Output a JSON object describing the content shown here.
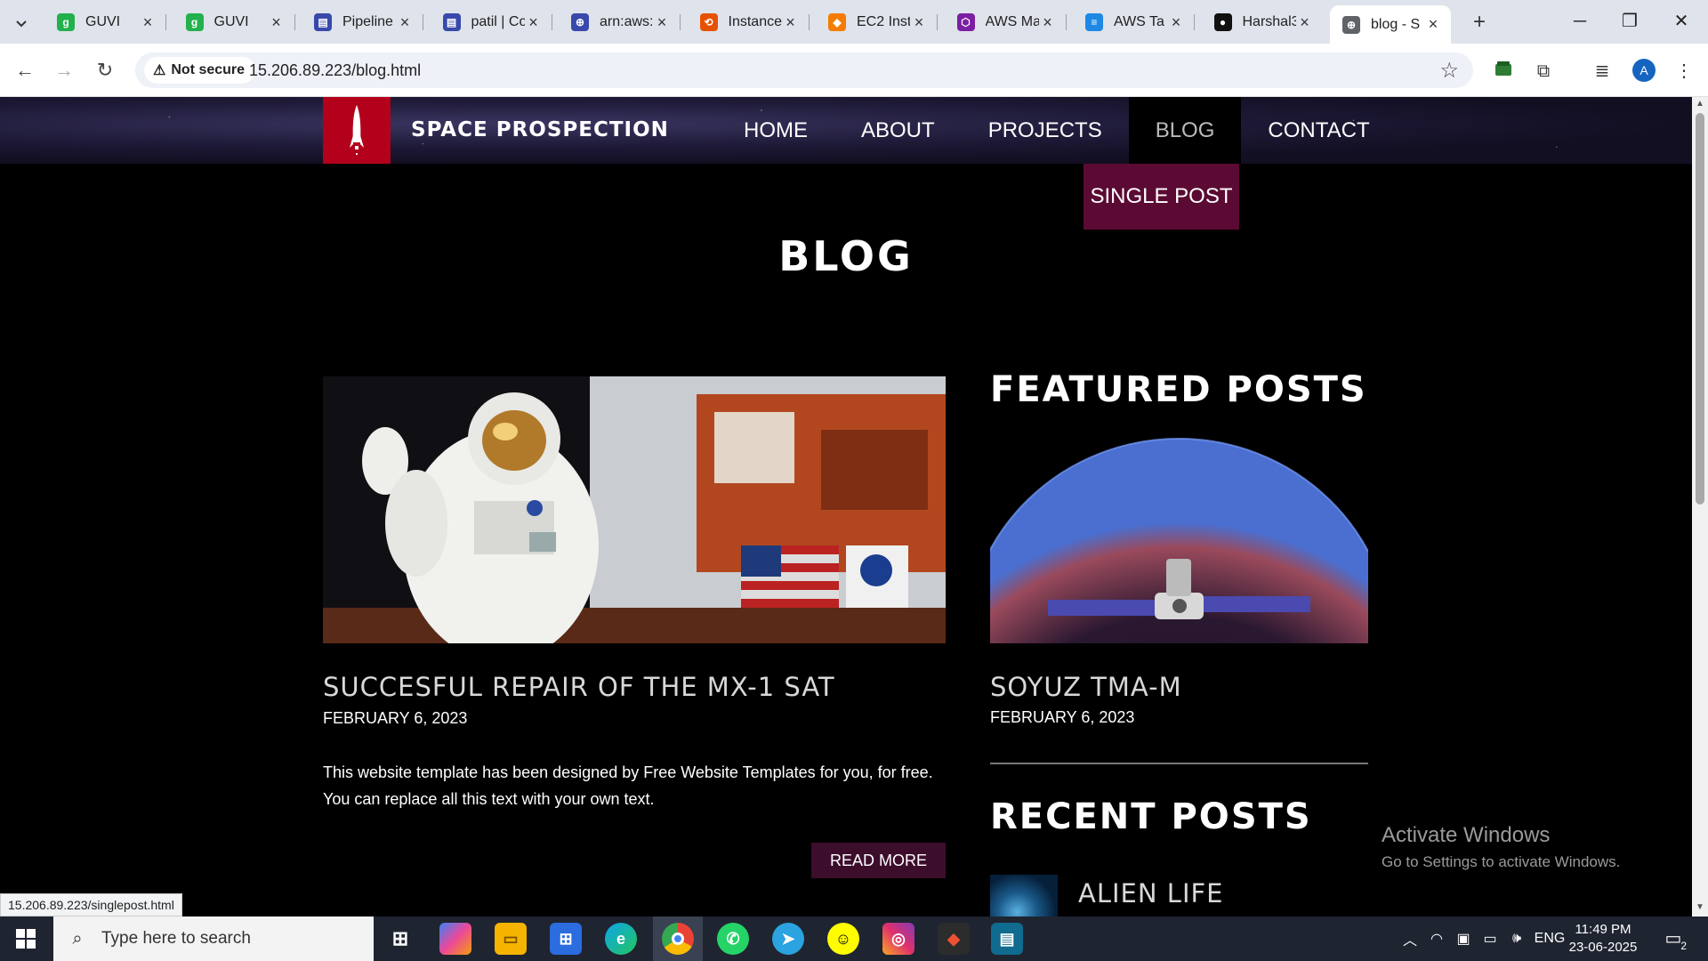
{
  "browser": {
    "tabs": [
      {
        "title": "GUVI",
        "fav_color": "#22b14c",
        "fav_glyph": "g"
      },
      {
        "title": "GUVI",
        "fav_color": "#22b14c",
        "fav_glyph": "g"
      },
      {
        "title": "Pipeline",
        "fav_color": "#3949ab",
        "fav_glyph": "▤"
      },
      {
        "title": "patil | Co",
        "fav_color": "#3949ab",
        "fav_glyph": "▤"
      },
      {
        "title": "arn:aws:",
        "fav_color": "#3949ab",
        "fav_glyph": "⊕"
      },
      {
        "title": "Instance",
        "fav_color": "#e65100",
        "fav_glyph": "⟲"
      },
      {
        "title": "EC2 Inst",
        "fav_color": "#f57c00",
        "fav_glyph": "◆"
      },
      {
        "title": "AWS Ma",
        "fav_color": "#7b1fa2",
        "fav_glyph": "⬡"
      },
      {
        "title": "AWS Ta",
        "fav_color": "#1e88e5",
        "fav_glyph": "≡"
      },
      {
        "title": "Harshal3",
        "fav_color": "#111111",
        "fav_glyph": "●"
      },
      {
        "title": "blog - S",
        "fav_color": "#5f6368",
        "fav_glyph": "⊕"
      }
    ],
    "security_label": "Not secure",
    "url": "15.206.89.223/blog.html",
    "profile_initial": "A",
    "status_url": "15.206.89.223/singlepost.html"
  },
  "site": {
    "name": "SPACE PROSPECTION",
    "nav": {
      "home": "HOME",
      "about": "ABOUT",
      "projects": "PROJECTS",
      "blog": "BLOG",
      "contact": "CONTACT"
    },
    "dropdown_item": "SINGLE POST",
    "page_title": "BLOG",
    "post": {
      "title": "SUCCESFUL REPAIR OF THE MX-1 SAT",
      "date": "FEBRUARY 6, 2023",
      "excerpt": "This website template has been designed by Free Website Templates for you, for free. You can replace all this text with your own text.",
      "read_more": "READ MORE"
    },
    "featured": {
      "heading": "FEATURED POSTS",
      "title": "SOYUZ TMA-M",
      "date": "FEBRUARY 6, 2023"
    },
    "recent": {
      "heading": "RECENT POSTS",
      "first_title": "ALIEN LIFE"
    }
  },
  "watermark": {
    "line1": "Activate Windows",
    "line2": "Go to Settings to activate Windows."
  },
  "taskbar": {
    "search_placeholder": "Type here to search",
    "language": "ENG",
    "time": "11:49 PM",
    "date": "23-06-2025",
    "notification_count": "2"
  }
}
